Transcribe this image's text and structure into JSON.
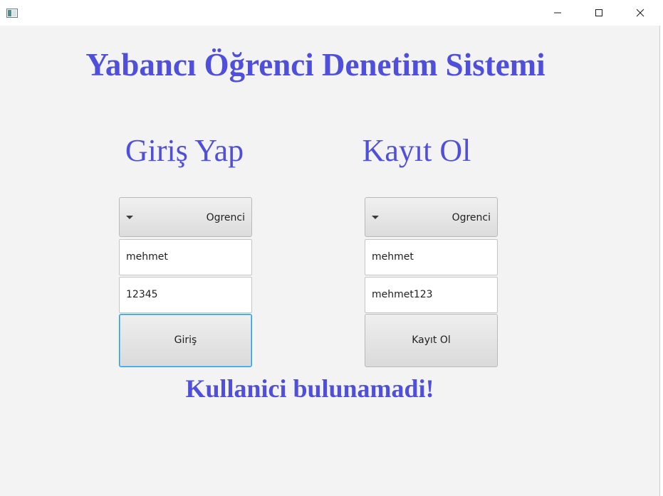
{
  "window": {
    "title": "",
    "icon": "window-app-icon",
    "controls": {
      "minimize_icon": "minimize-icon",
      "maximize_icon": "maximize-icon",
      "close_icon": "close-icon"
    }
  },
  "colors": {
    "accent": "#4f4fdc",
    "background": "#f3f3f3",
    "focus": "#2196f3"
  },
  "app": {
    "title": "Yabancı Öğrenci Denetim Sistemi"
  },
  "login": {
    "heading": "Giriş Yap",
    "role_selected": "Ogrenci",
    "username_value": "mehmet",
    "password_value": "12345",
    "submit_label": "Giriş"
  },
  "register": {
    "heading": "Kayıt Ol",
    "role_selected": "Ogrenci",
    "username_value": "mehmet",
    "password_value": "mehmet123",
    "submit_label": "Kayıt Ol"
  },
  "status": {
    "message": "Kullanici bulunamadi!"
  }
}
